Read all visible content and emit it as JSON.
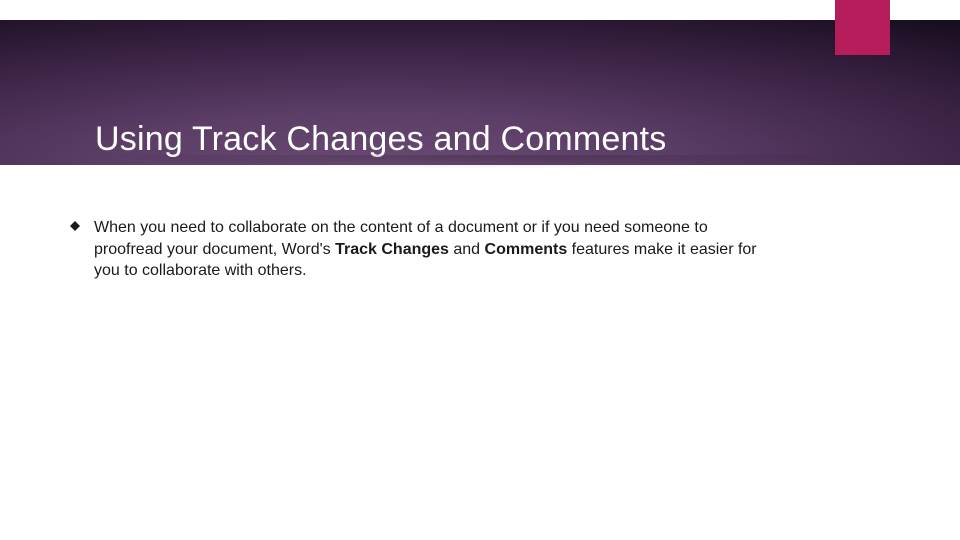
{
  "colors": {
    "accent": "#b61e5b",
    "header_gradient_dark": "#0b0612",
    "header_gradient_light": "#6a4a74",
    "text": "#1a1a1a",
    "title": "#ffffff"
  },
  "header": {
    "title": "Using Track Changes and Comments"
  },
  "body": {
    "bullets": [
      {
        "segments": [
          {
            "text": "When you need to collaborate on the content of a document or if you need someone to proofread your document, Word's ",
            "bold": false
          },
          {
            "text": "Track Changes",
            "bold": true
          },
          {
            "text": " and ",
            "bold": false
          },
          {
            "text": "Comments",
            "bold": true
          },
          {
            "text": " features make it easier for you to collaborate with others.",
            "bold": false
          }
        ]
      }
    ]
  },
  "icons": {
    "bullet": "diamond-icon"
  }
}
